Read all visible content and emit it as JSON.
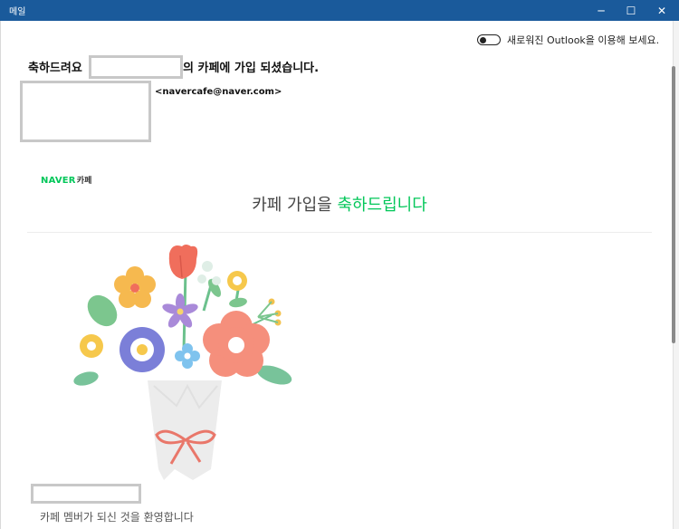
{
  "window": {
    "title": "메일",
    "minimize_icon": "─",
    "maximize_icon": "☐",
    "close_icon": "✕"
  },
  "toolbar": {
    "outlook_toggle_label": "새로워진 Outlook을 이용해 보세요."
  },
  "message": {
    "subject_prefix": "축하드려요",
    "subject_suffix": "의 카페에 가입 되셨습니다.",
    "sender_email": "<navercafe@naver.com>"
  },
  "body": {
    "brand_main": "NAVER",
    "brand_sub": "카페",
    "headline_prefix": "카페 가입을 ",
    "headline_accent": "축하드립니다",
    "welcome_text": "카페 멤버가 되신 것을 환영합니다"
  },
  "colors": {
    "titlebar": "#1a5a9b",
    "naver_green": "#03c75a",
    "redaction_gray": "#c8c8c8"
  },
  "icons": {
    "toggle": "toggle-off-icon",
    "illustration": "flower-bouquet-illustration"
  }
}
